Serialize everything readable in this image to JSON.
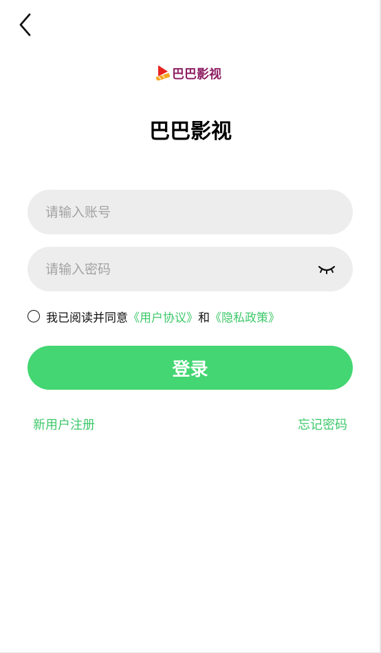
{
  "header": {
    "back_icon": "chevron-left-icon"
  },
  "logo": {
    "icon": "play-clapper-logo-icon",
    "text": "巴巴影视",
    "color": "#8e1f63"
  },
  "app_title": "巴巴影视",
  "form": {
    "account_placeholder": "请输入账号",
    "account_value": "",
    "password_placeholder": "请输入密码",
    "password_value": "",
    "password_toggle_icon": "eye-closed-icon"
  },
  "agreement": {
    "checked": false,
    "prefix": "我已阅读并同意",
    "user_agreement": "《用户协议》",
    "connector": "和",
    "privacy_policy": "《隐私政策》"
  },
  "login_button": "登录",
  "links": {
    "register": "新用户注册",
    "forgot_password": "忘记密码"
  },
  "colors": {
    "accent": "#43d672",
    "link": "#3dc86a",
    "input_bg": "#ededed"
  }
}
